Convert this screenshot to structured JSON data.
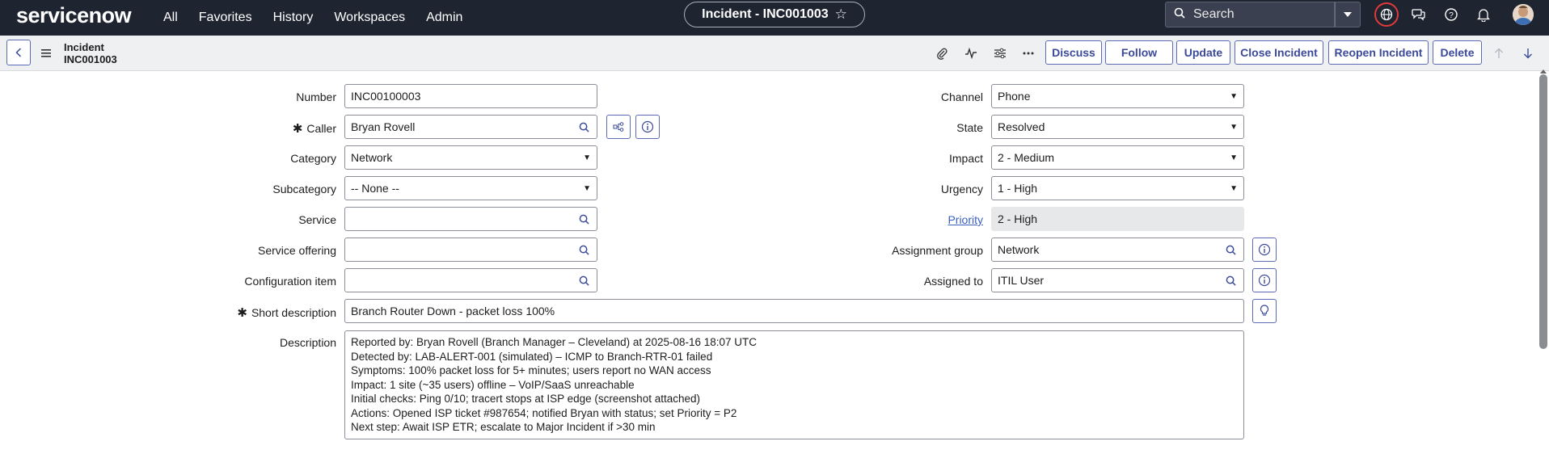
{
  "header": {
    "logo": "servicenow",
    "nav": [
      "All",
      "Favorites",
      "History",
      "Workspaces",
      "Admin"
    ],
    "record_pill": "Incident - INC001003",
    "search_placeholder": "Search"
  },
  "toolbar": {
    "record_type": "Incident",
    "record_number": "INC001003",
    "buttons": {
      "discuss": "Discuss",
      "follow": "Follow",
      "update": "Update",
      "close": "Close Incident",
      "reopen": "Reopen Incident",
      "delete": "Delete"
    }
  },
  "form": {
    "number": {
      "label": "Number",
      "value": "INC00100003"
    },
    "caller": {
      "label": "Caller",
      "value": "Bryan Rovell"
    },
    "category": {
      "label": "Category",
      "value": "Network"
    },
    "subcategory": {
      "label": "Subcategory",
      "value": "-- None --"
    },
    "service": {
      "label": "Service",
      "value": ""
    },
    "service_offering": {
      "label": "Service offering",
      "value": ""
    },
    "configuration_item": {
      "label": "Configuration item",
      "value": ""
    },
    "short_description": {
      "label": "Short description",
      "value": "Branch Router Down - packet loss 100%"
    },
    "description": {
      "label": "Description",
      "lines": [
        "Reported by: Bryan Rovell (Branch Manager – Cleveland) at 2025-08-16 18:07 UTC",
        "Detected by: LAB-ALERT-001 (simulated) – ICMP to Branch-RTR-01 failed",
        "Symptoms: 100% packet loss for 5+ minutes; users report no WAN access",
        "Impact: 1 site (~35 users) offline – VoIP/SaaS unreachable",
        "Initial checks: Ping 0/10; tracert stops at ISP edge (screenshot attached)",
        "Actions: Opened ISP ticket #987654; notified Bryan with status; set Priority = P2",
        "Next step: Await ISP ETR; escalate to Major Incident if >30 min"
      ]
    },
    "channel": {
      "label": "Channel",
      "value": "Phone"
    },
    "state": {
      "label": "State",
      "value": "Resolved"
    },
    "impact": {
      "label": "Impact",
      "value": "2 - Medium"
    },
    "urgency": {
      "label": "Urgency",
      "value": "1 - High"
    },
    "priority": {
      "label": "Priority",
      "value": "2 - High"
    },
    "assignment_group": {
      "label": "Assignment group",
      "value": "Network"
    },
    "assigned_to": {
      "label": "Assigned to",
      "value": "ITIL User"
    }
  },
  "colors": {
    "nav_bg": "#1f2431",
    "accent": "#3b4a9a",
    "alert_ring": "#e03a3a"
  }
}
